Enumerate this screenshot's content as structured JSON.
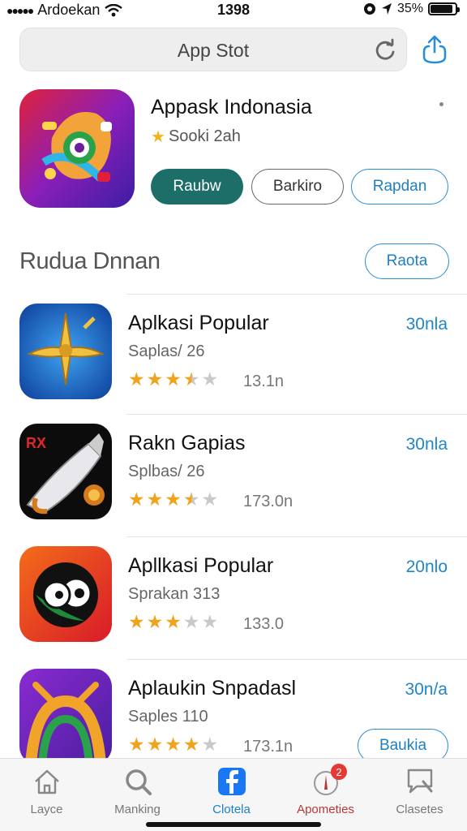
{
  "status_bar": {
    "carrier": "Ardoekan",
    "time": "1398",
    "battery": "35%",
    "battery_level": 0.9
  },
  "search": {
    "title": "App Stot",
    "reload_icon": "reload-icon",
    "share_icon": "share-icon"
  },
  "featured": {
    "title": "Appask Indonasia",
    "rating_text": "Sooki 2ah",
    "buttons": {
      "primary": "Raubw",
      "secondary": "Barkiro",
      "tertiary": "Rapdan"
    }
  },
  "section": {
    "title": "Rudua Dnnan",
    "action": "Raota"
  },
  "apps": [
    {
      "name": "Aplkasi Popular",
      "subtitle": "Saplas/ 26",
      "rating": 3.5,
      "count": "13.1n",
      "size": "30nla"
    },
    {
      "name": "Rakn Gapias",
      "subtitle": "Splbas/ 26",
      "rating": 3.5,
      "count": "173.0n",
      "size": "30nla"
    },
    {
      "name": "Apllkasi Popular",
      "subtitle": "Sprakan 313",
      "rating": 3,
      "count": "133.0",
      "size": "20nlo"
    },
    {
      "name": "Aplaukin Snpadasl",
      "subtitle": "Saples 110",
      "rating": 4,
      "count": "173.1n",
      "size": "30n/a",
      "button": "Baukia"
    }
  ],
  "tabbar": {
    "tabs": [
      {
        "label": "Layce",
        "icon": "home-icon"
      },
      {
        "label": "Manking",
        "icon": "search-icon"
      },
      {
        "label": "Clotela",
        "icon": "facebook-icon"
      },
      {
        "label": "Apometies",
        "icon": "notification-icon",
        "badge": "2"
      },
      {
        "label": "Clasetes",
        "icon": "chat-search-icon"
      }
    ]
  },
  "colors": {
    "accent_blue": "#1f7fc2",
    "primary_button": "#1d6d69",
    "star": "#f0a31d",
    "badge": "#e53935"
  }
}
